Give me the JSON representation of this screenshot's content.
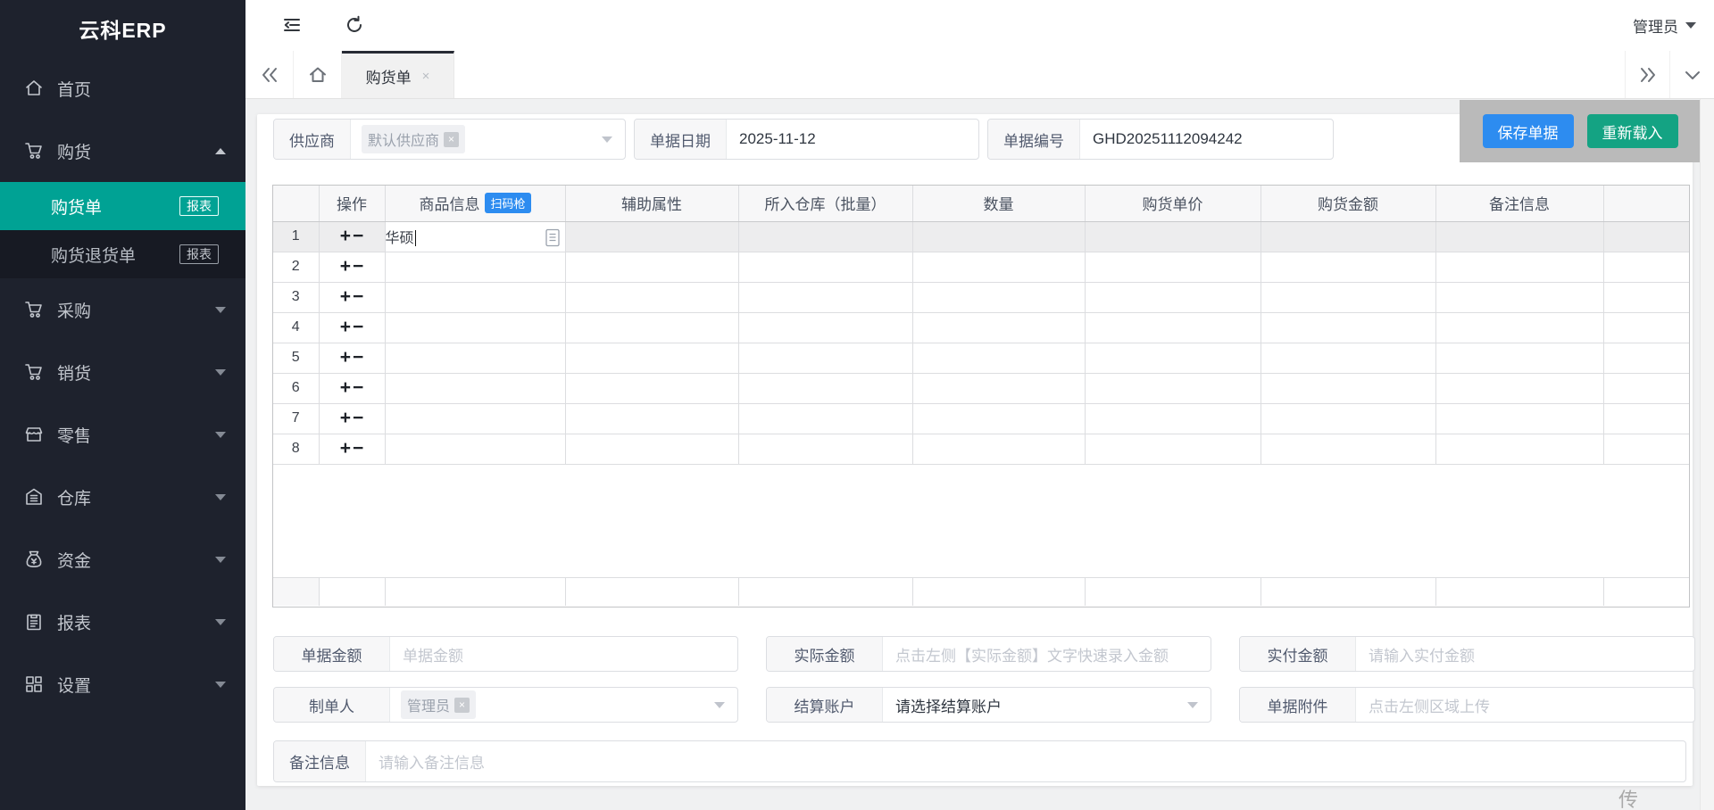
{
  "app": {
    "title": "云科ERP"
  },
  "topbar": {
    "user": "管理员"
  },
  "sidebar": {
    "items": [
      {
        "label": "首页",
        "icon": "home-icon"
      },
      {
        "label": "购货",
        "icon": "cart-icon",
        "expanded": true,
        "children": [
          {
            "label": "购货单",
            "badge": "报表",
            "active": true
          },
          {
            "label": "购货退货单",
            "badge": "报表"
          }
        ]
      },
      {
        "label": "采购",
        "icon": "cart-icon"
      },
      {
        "label": "销货",
        "icon": "cart-icon"
      },
      {
        "label": "零售",
        "icon": "shop-icon"
      },
      {
        "label": "仓库",
        "icon": "warehouse-icon"
      },
      {
        "label": "资金",
        "icon": "money-icon"
      },
      {
        "label": "报表",
        "icon": "report-icon"
      },
      {
        "label": "设置",
        "icon": "settings-icon"
      }
    ]
  },
  "tabbar": {
    "tab_label": "购货单",
    "close_glyph": "×"
  },
  "form_top": {
    "supplier_label": "供应商",
    "supplier_tag": "默认供应商",
    "date_label": "单据日期",
    "date_value": "2025-11-12",
    "number_label": "单据编号",
    "number_value": "GHD20251112094242"
  },
  "actions": {
    "save_label": "保存单据",
    "reload_label": "重新载入"
  },
  "table": {
    "headers": [
      "操作",
      "商品信息",
      "辅助属性",
      "所入仓库（批量）",
      "数量",
      "购货单价",
      "购货金额",
      "备注信息"
    ],
    "scan_badge": "扫码枪",
    "op_add": "+",
    "op_del": "−",
    "rows": [
      {
        "num": "1",
        "product": "华硕"
      },
      {
        "num": "2",
        "product": ""
      },
      {
        "num": "3",
        "product": ""
      },
      {
        "num": "4",
        "product": ""
      },
      {
        "num": "5",
        "product": ""
      },
      {
        "num": "6",
        "product": ""
      },
      {
        "num": "7",
        "product": ""
      },
      {
        "num": "8",
        "product": ""
      }
    ]
  },
  "form_bottom": {
    "amount_label": "单据金额",
    "amount_placeholder": "单据金额",
    "actual_label": "实际金额",
    "actual_placeholder": "点击左侧【实际金额】文字快速录入金额",
    "paid_label": "实付金额",
    "paid_placeholder": "请输入实付金额",
    "maker_label": "制单人",
    "maker_tag": "管理员",
    "account_label": "结算账户",
    "account_value": "请选择结算账户",
    "attach_label": "单据附件",
    "attach_placeholder": "点击左侧区域上传",
    "remark_label": "备注信息",
    "remark_placeholder": "请输入备注信息"
  },
  "watermark": {
    "text": "传"
  },
  "colors": {
    "sidebar_bg": "#1e222d",
    "active_teal": "#00a294",
    "save_blue": "#2d8cf0",
    "reload_green": "#14a383",
    "scan_badge_blue": "#2d8cf0"
  }
}
